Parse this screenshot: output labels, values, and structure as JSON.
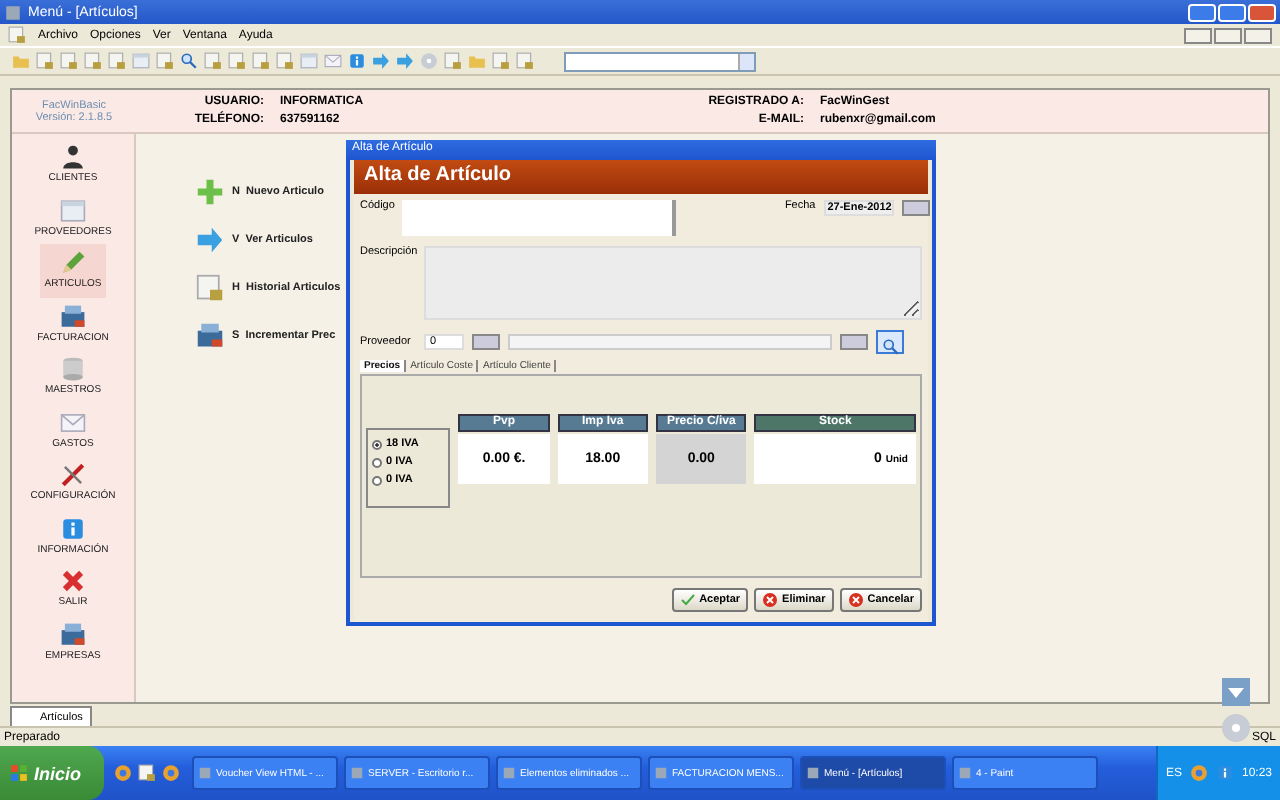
{
  "window": {
    "title": "Menú - [Artículos]"
  },
  "menu": [
    "Archivo",
    "Opciones",
    "Ver",
    "Ventana",
    "Ayuda"
  ],
  "header": {
    "app_name": "FacWinBasic",
    "version": "Versión: 2.1.8.5",
    "user_label": "USUARIO:",
    "user": "INFORMATICA",
    "phone_label": "TELÉFONO:",
    "phone": "637591162",
    "registered_label": "REGISTRADO A:",
    "registered": "FacWinGest",
    "email_label": "E-MAIL:",
    "email": "rubenxr@gmail.com"
  },
  "sidebar": {
    "items": [
      {
        "label": "CLIENTES",
        "selected": false
      },
      {
        "label": "PROVEEDORES",
        "selected": false
      },
      {
        "label": "ARTICULOS",
        "selected": true
      },
      {
        "label": "FACTURACION",
        "selected": false
      },
      {
        "label": "MAESTROS",
        "selected": false
      },
      {
        "label": "GASTOS",
        "selected": false
      },
      {
        "label": "CONFIGURACIÓN",
        "selected": false
      },
      {
        "label": "INFORMACIÓN",
        "selected": false
      },
      {
        "label": "SALIR",
        "selected": false
      },
      {
        "label": "EMPRESAS",
        "selected": false
      }
    ]
  },
  "actions": [
    {
      "key": "N",
      "label": "Nuevo Articulo"
    },
    {
      "key": "V",
      "label": "Ver Articulos"
    },
    {
      "key": "H",
      "label": "Historial Articulos"
    },
    {
      "key": "S",
      "label": "Incrementar Prec"
    }
  ],
  "dialog": {
    "title": "Alta de Artículo",
    "banner": "Alta de Artículo",
    "code_label": "Código",
    "date_label": "Fecha",
    "date": "27-Ene-2012",
    "description_label": "Descripción",
    "supplier_label": "Proveedor",
    "supplier": "0",
    "tabs": [
      {
        "label": "Precios",
        "selected": true
      },
      {
        "label": "Artículo Coste",
        "selected": false
      },
      {
        "label": "Artículo Cliente",
        "selected": false
      }
    ],
    "iva_options": [
      {
        "label": "18 IVA",
        "selected": true
      },
      {
        "label": "0 IVA",
        "selected": false
      },
      {
        "label": "0 IVA",
        "selected": false
      }
    ],
    "prices": [
      {
        "label": "Pvp",
        "value": "0.00 €.",
        "kind": "editable"
      },
      {
        "label": "Imp Iva",
        "value": "18.00",
        "kind": "editable"
      },
      {
        "label": "Precio C/iva",
        "value": "0.00",
        "kind": "readonly"
      },
      {
        "label": "Stock",
        "value": "0",
        "unit": "Unid",
        "kind": "stock"
      }
    ],
    "buttons": [
      "Aceptar",
      "Eliminar",
      "Cancelar"
    ]
  },
  "document_tabs": [
    {
      "label": "Artículos",
      "selected": true
    }
  ],
  "status_bar": {
    "message": "Preparado",
    "mode": "SQL"
  },
  "taskbar": {
    "start": "Inicio",
    "tasks": [
      {
        "label": "Voucher View HTML - ...",
        "selected": false
      },
      {
        "label": "SERVER - Escritorio r...",
        "selected": false
      },
      {
        "label": "Elementos eliminados ...",
        "selected": false
      },
      {
        "label": "FACTURACION MENS...",
        "selected": false
      },
      {
        "label": "Menú - [Artículos]",
        "selected": true
      },
      {
        "label": "4 - Paint",
        "selected": false
      }
    ],
    "language": "ES",
    "time": "10:23"
  }
}
